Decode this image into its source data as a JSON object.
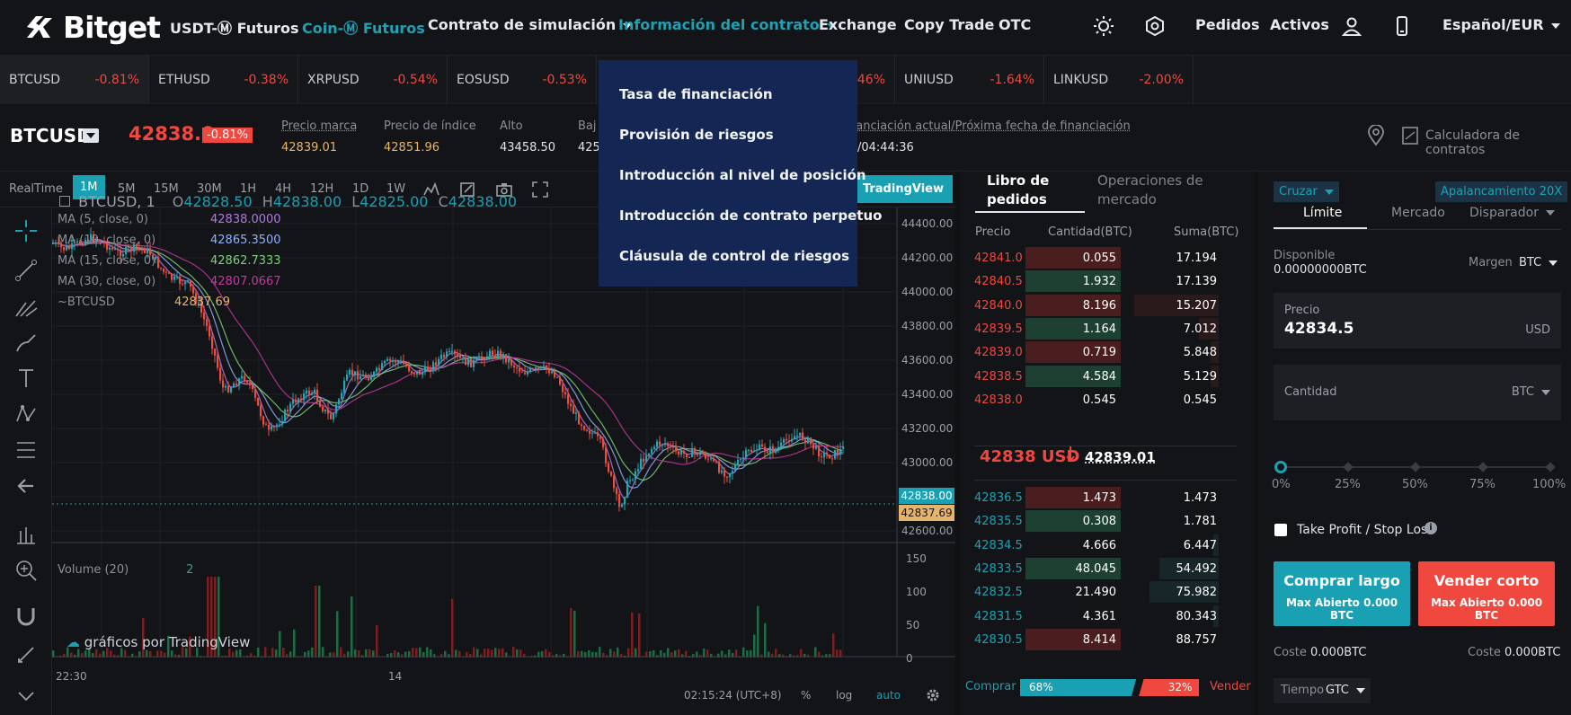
{
  "nav": {
    "logo": "Bitget",
    "items": [
      "USDT-Ⓜ Futuros",
      "Coin-Ⓜ Futuros",
      "Contrato de simulación",
      "Información del contrato",
      "Exchange",
      "Copy Trade",
      "OTC"
    ],
    "orders": "Pedidos",
    "assets": "Activos",
    "lang": "Español/EUR"
  },
  "dropdown": [
    "Tasa de financiación",
    "Provisión de riesgos",
    "Introducción al nivel de posición",
    "Introducción de contrato perpetuo",
    "Cláusula de control de riesgos"
  ],
  "ticker": [
    {
      "sym": "BTCUSD",
      "chg": "-0.81%"
    },
    {
      "sym": "ETHUSD",
      "chg": "-0.38%"
    },
    {
      "sym": "XRPUSD",
      "chg": "-0.54%"
    },
    {
      "sym": "EOSUSD",
      "chg": "-0.53%"
    },
    {
      "sym": "",
      "chg": "-0.46%"
    },
    {
      "sym": "UNIUSD",
      "chg": "-1.64%"
    },
    {
      "sym": "LINKUSD",
      "chg": "-2.00%"
    }
  ],
  "symbol": {
    "name": "BTCUSD",
    "price": "42838.0",
    "change": "-0.81%",
    "mark_label": "Precio marca",
    "mark": "42839.01",
    "index_label": "Precio de índice",
    "index": "42851.96",
    "high_label": "Alto",
    "high": "43458.50",
    "low_label": "Baj",
    "low": "425",
    "funding_label": "nanciación actual/Próxima fecha de financiación",
    "funding": "/04:44:36",
    "calc": "Calculadora de contratos"
  },
  "timeframes": [
    "RealTime",
    "1M",
    "5M",
    "15M",
    "30M",
    "1H",
    "4H",
    "12H",
    "1D",
    "1W"
  ],
  "tradingview": "TradingView",
  "chart": {
    "title": "BTCUSD, 1",
    "o": "42828.50",
    "h": "42838.00",
    "l": "42825.00",
    "c": "42838.00",
    "ma": [
      {
        "label": "MA (5, close, 0)",
        "value": "42838.0000",
        "color": "#b07adf"
      },
      {
        "label": "MA (10, close, 0)",
        "value": "42865.3500",
        "color": "#8fb0ff"
      },
      {
        "label": "MA (15, close, 0)",
        "value": "42862.7333",
        "color": "#7ed07a"
      },
      {
        "label": "MA (30, close, 0)",
        "value": "42807.0667",
        "color": "#c0399e"
      }
    ],
    "btc_label": "~BTCUSD",
    "btc_value": "42837.69",
    "yticks": [
      "44400.00",
      "44200.00",
      "44000.00",
      "43800.00",
      "43600.00",
      "43400.00",
      "43200.00",
      "43000.00",
      "42800.00",
      "42600.00"
    ],
    "last_price": "42838.00",
    "last_price2": "42837.69",
    "volume_label": "Volume (20)",
    "volume_val": "2",
    "vticks": [
      "150",
      "100",
      "50",
      "0"
    ],
    "xticks": [
      "22:30",
      "14"
    ],
    "watermark": "gráficos por TradingView",
    "time": "02:15:24 (UTC+8)",
    "pct": "%",
    "log": "log",
    "auto": "auto"
  },
  "book": {
    "tab1": "Libro de pedidos",
    "tab2": "Operaciones de mercado",
    "h_price": "Precio",
    "h_qty": "Cantidad(BTC)",
    "h_sum": "Suma(BTC)",
    "asks": [
      {
        "p": "42841.0",
        "q": "0.055",
        "s": "17.194",
        "qf": 1.0,
        "sf": 0.0
      },
      {
        "p": "42840.5",
        "q": "1.932",
        "s": "17.139",
        "qf": 1.0,
        "sf": 0.0
      },
      {
        "p": "42840.0",
        "q": "8.196",
        "s": "15.207",
        "qf": 1.0,
        "sf": 0.85
      },
      {
        "p": "42839.5",
        "q": "1.164",
        "s": "7.012",
        "qf": 1.0,
        "sf": 0.2
      },
      {
        "p": "42839.0",
        "q": "0.719",
        "s": "5.848",
        "qf": 1.0,
        "sf": 0.08
      },
      {
        "p": "42838.5",
        "q": "4.584",
        "s": "5.129",
        "qf": 1.0,
        "sf": 0.08
      },
      {
        "p": "42838.0",
        "q": "0.545",
        "s": "0.545",
        "qf": 0,
        "sf": 0
      }
    ],
    "mid": "42838 USD",
    "mid_mark": "42839.01",
    "bids": [
      {
        "p": "42836.5",
        "q": "1.473",
        "s": "1.473",
        "qf": 1.0,
        "sf": 0.0
      },
      {
        "p": "42835.5",
        "q": "0.308",
        "s": "1.781",
        "qf": 1.0,
        "sf": 0.0
      },
      {
        "p": "42834.5",
        "q": "4.666",
        "s": "6.447",
        "qf": 0,
        "sf": 0.05
      },
      {
        "p": "42833.5",
        "q": "48.045",
        "s": "54.492",
        "qf": 1.0,
        "sf": 0.6
      },
      {
        "p": "42832.5",
        "q": "21.490",
        "s": "75.982",
        "qf": 0,
        "sf": 0.7
      },
      {
        "p": "42831.5",
        "q": "4.361",
        "s": "80.343",
        "qf": 0,
        "sf": 0.05
      },
      {
        "p": "42830.5",
        "q": "8.414",
        "s": "88.757",
        "qf": 1.0,
        "sf": 0.0
      }
    ],
    "buy": "Comprar",
    "buy_pct": "68%",
    "sell_pct": "32%",
    "sell": "Vender"
  },
  "form": {
    "mode": "Cruzar",
    "leverage": "Apalancamiento 20X",
    "tabs": [
      "Límite",
      "Mercado",
      "Disparador"
    ],
    "avail_label": "Disponible",
    "avail": "0.00000000BTC",
    "margin_label": "Margen",
    "margin": "BTC",
    "price_label": "Precio",
    "price": "42834.5",
    "price_unit": "USD",
    "qty_label": "Cantidad",
    "qty_unit": "BTC",
    "slider": [
      "0%",
      "25%",
      "50%",
      "75%",
      "100%"
    ],
    "tpsl": "Take Profit / Stop Loss",
    "buy_btn": "Comprar largo",
    "sell_btn": "Vender corto",
    "max_open": "Max Abierto 0.000 BTC",
    "cost_label": "Coste",
    "cost": "0.000BTC",
    "time_label": "Tiempo",
    "time": "GTC"
  },
  "colors": {
    "accent": "#1aa0b3",
    "red": "#f0483e",
    "green": "#2ea682"
  }
}
